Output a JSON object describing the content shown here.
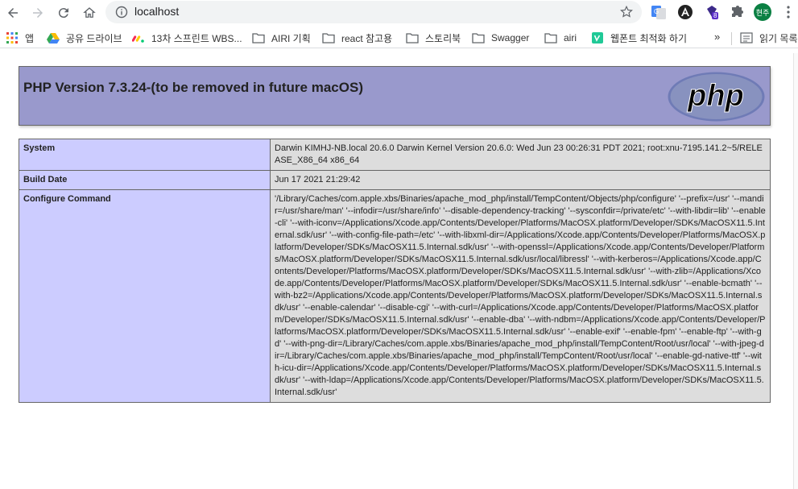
{
  "browser": {
    "url": "localhost",
    "profile_initials": "현주",
    "extension_badge": "8"
  },
  "bookmarks": [
    {
      "label": "앱",
      "icon": "apps-grid-icon"
    },
    {
      "label": "공유 드라이브",
      "icon": "google-drive-icon"
    },
    {
      "label": "13차 스프린트 WBS...",
      "icon": "monday-icon"
    },
    {
      "label": "AIRI 기획",
      "icon": "folder-icon"
    },
    {
      "label": "react 참고용",
      "icon": "folder-icon"
    },
    {
      "label": "스토리북",
      "icon": "folder-icon"
    },
    {
      "label": "Swagger",
      "icon": "folder-icon"
    },
    {
      "label": "airi",
      "icon": "folder-icon"
    },
    {
      "label": "웹폰트 최적화 하기",
      "icon": "velog-icon"
    }
  ],
  "bookmarks_overflow": "»",
  "reading_list": "읽기 목록",
  "php": {
    "title": "PHP Version 7.3.24-(to be removed in future macOS)",
    "logo_text": "php"
  },
  "rows": [
    {
      "key": "System",
      "value": "Darwin KIMHJ-NB.local 20.6.0 Darwin Kernel Version 20.6.0: Wed Jun 23 00:26:31 PDT 2021; root:xnu-7195.141.2~5/RELEASE_X86_64 x86_64"
    },
    {
      "key": "Build Date",
      "value": "Jun 17 2021 21:29:42"
    },
    {
      "key": "Configure Command",
      "value": "'/Library/Caches/com.apple.xbs/Binaries/apache_mod_php/install/TempContent/Objects/php/configure' '--prefix=/usr' '--mandir=/usr/share/man' '--infodir=/usr/share/info' '--disable-dependency-tracking' '--sysconfdir=/private/etc' '--with-libdir=lib' '--enable-cli' '--with-iconv=/Applications/Xcode.app/Contents/Developer/Platforms/MacOSX.platform/Developer/SDKs/MacOSX11.5.Internal.sdk/usr' '--with-config-file-path=/etc' '--with-libxml-dir=/Applications/Xcode.app/Contents/Developer/Platforms/MacOSX.platform/Developer/SDKs/MacOSX11.5.Internal.sdk/usr' '--with-openssl=/Applications/Xcode.app/Contents/Developer/Platforms/MacOSX.platform/Developer/SDKs/MacOSX11.5.Internal.sdk/usr/local/libressl' '--with-kerberos=/Applications/Xcode.app/Contents/Developer/Platforms/MacOSX.platform/Developer/SDKs/MacOSX11.5.Internal.sdk/usr' '--with-zlib=/Applications/Xcode.app/Contents/Developer/Platforms/MacOSX.platform/Developer/SDKs/MacOSX11.5.Internal.sdk/usr' '--enable-bcmath' '--with-bz2=/Applications/Xcode.app/Contents/Developer/Platforms/MacOSX.platform/Developer/SDKs/MacOSX11.5.Internal.sdk/usr' '--enable-calendar' '--disable-cgi' '--with-curl=/Applications/Xcode.app/Contents/Developer/Platforms/MacOSX.platform/Developer/SDKs/MacOSX11.5.Internal.sdk/usr' '--enable-dba' '--with-ndbm=/Applications/Xcode.app/Contents/Developer/Platforms/MacOSX.platform/Developer/SDKs/MacOSX11.5.Internal.sdk/usr' '--enable-exif' '--enable-fpm' '--enable-ftp' '--with-gd' '--with-png-dir=/Library/Caches/com.apple.xbs/Binaries/apache_mod_php/install/TempContent/Root/usr/local' '--with-jpeg-dir=/Library/Caches/com.apple.xbs/Binaries/apache_mod_php/install/TempContent/Root/usr/local' '--enable-gd-native-ttf' '--with-icu-dir=/Applications/Xcode.app/Contents/Developer/Platforms/MacOSX.platform/Developer/SDKs/MacOSX11.5.Internal.sdk/usr' '--with-ldap=/Applications/Xcode.app/Contents/Developer/Platforms/MacOSX.platform/Developer/SDKs/MacOSX11.5.Internal.sdk/usr'"
    }
  ]
}
